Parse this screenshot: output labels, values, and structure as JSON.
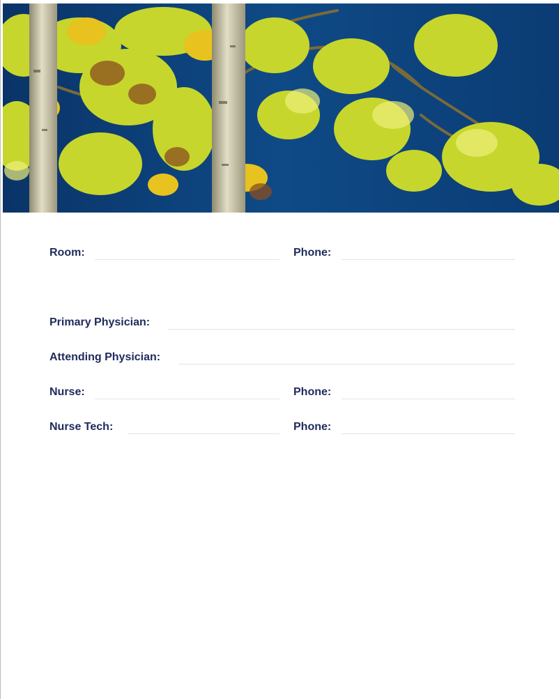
{
  "colors": {
    "label": "#1f2a5c",
    "line": "#e1e4ea",
    "sky": "#0d3f7a",
    "leaf": "#c9d92e",
    "trunk": "#cfcbb4"
  },
  "banner": {
    "icon": "aspen-trees-photo"
  },
  "form": {
    "room_label": "Room:",
    "room_phone_label": "Phone:",
    "primary_physician_label": "Primary Physician:",
    "attending_physician_label": "Attending Physician:",
    "nurse_label": "Nurse:",
    "nurse_phone_label": "Phone:",
    "nurse_tech_label": "Nurse Tech:",
    "nurse_tech_phone_label": "Phone:"
  }
}
